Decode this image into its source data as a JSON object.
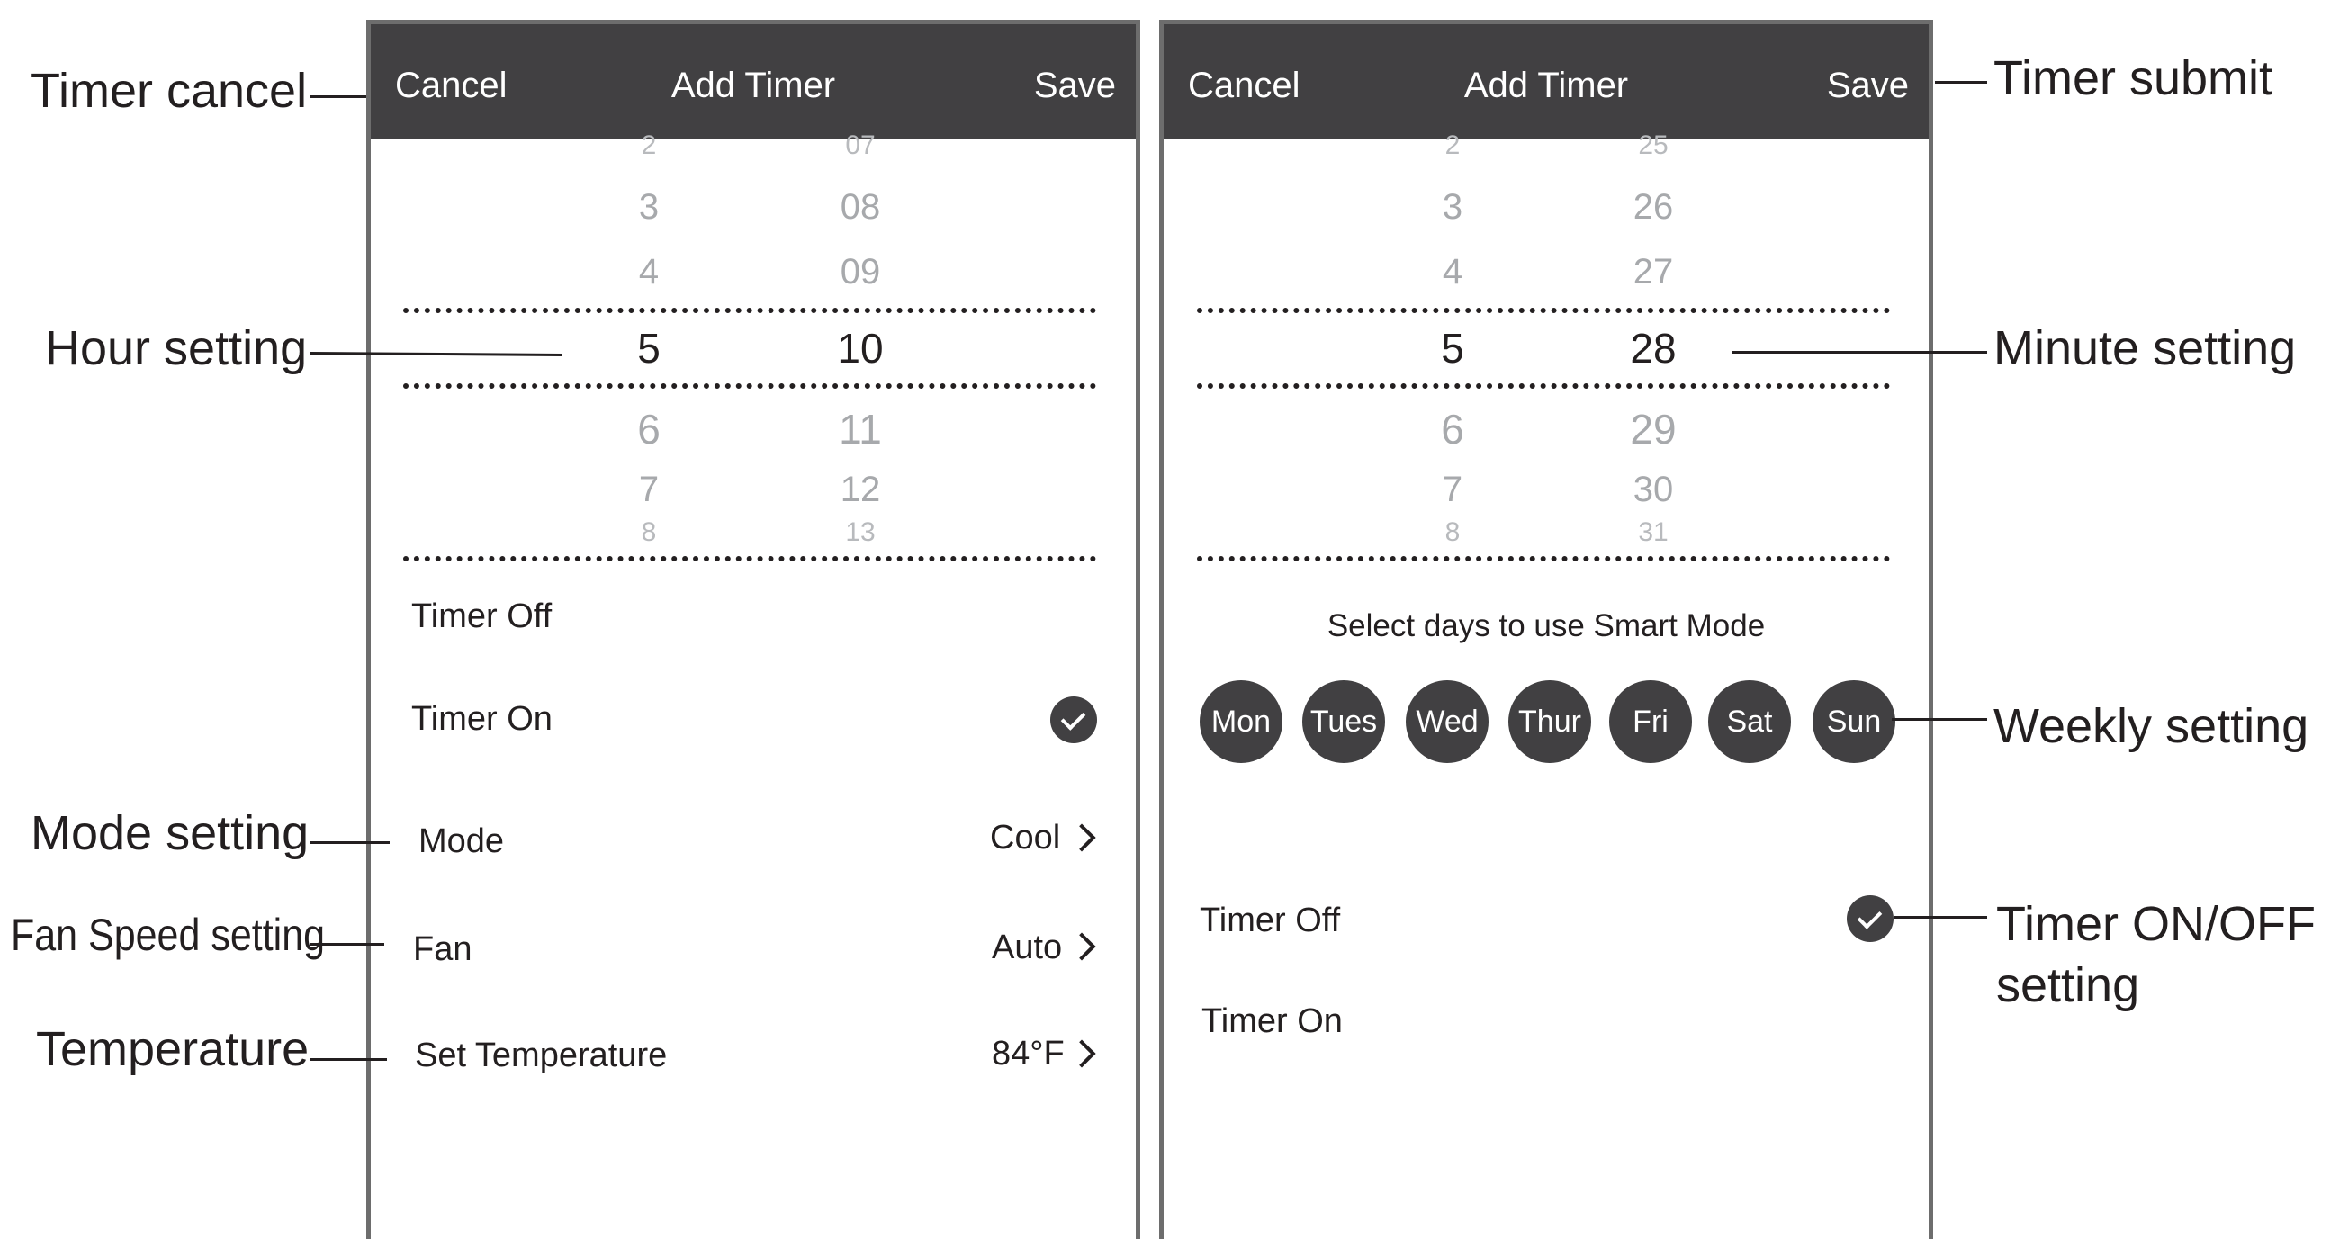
{
  "left_screen": {
    "header": {
      "cancel": "Cancel",
      "title": "Add Timer",
      "save": "Save"
    },
    "hour_wheel": [
      "2",
      "3",
      "4",
      "5",
      "6",
      "7",
      "8"
    ],
    "minute_wheel": [
      "07",
      "08",
      "09",
      "10",
      "11",
      "12",
      "13"
    ],
    "selected": {
      "hour": "5",
      "minute": "10"
    },
    "options": {
      "timer_off": "Timer Off",
      "timer_on": "Timer On",
      "selected": "Timer On"
    },
    "settings": [
      {
        "label": "Mode",
        "value": "Cool"
      },
      {
        "label": "Fan",
        "value": "Auto"
      },
      {
        "label": "Set Temperature",
        "value": "84°F"
      }
    ]
  },
  "right_screen": {
    "header": {
      "cancel": "Cancel",
      "title": "Add Timer",
      "save": "Save"
    },
    "hour_wheel": [
      "2",
      "3",
      "4",
      "5",
      "6",
      "7",
      "8"
    ],
    "minute_wheel": [
      "25",
      "26",
      "27",
      "28",
      "29",
      "30",
      "31"
    ],
    "selected": {
      "hour": "5",
      "minute": "28"
    },
    "days_prompt": "Select days to use Smart Mode",
    "days": [
      "Mon",
      "Tues",
      "Wed",
      "Thur",
      "Fri",
      "Sat",
      "Sun"
    ],
    "options": {
      "timer_off": "Timer Off",
      "timer_on": "Timer On",
      "selected": "Timer Off"
    }
  },
  "annotations": {
    "timer_cancel": "Timer cancel",
    "hour_setting": "Hour setting",
    "mode_setting": "Mode setting",
    "fan_speed_setting": "Fan Speed setting",
    "temperature": "Temperature",
    "timer_submit": "Timer submit",
    "minute_setting": "Minute setting",
    "weekly_setting": "Weekly setting",
    "timer_onoff_line1": "Timer ON/OFF",
    "timer_onoff_line2": "setting"
  },
  "colors": {
    "header_bg": "#414042",
    "text": "#231f20",
    "faded": "#a7a9ac",
    "frame": "#6d6d6d"
  }
}
